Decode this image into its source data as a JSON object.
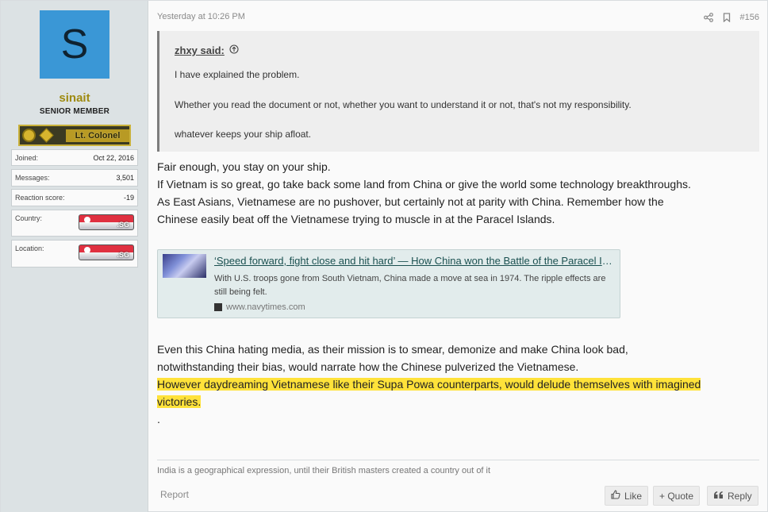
{
  "user": {
    "avatar_letter": "S",
    "avatar_color": "#3a97d6",
    "name": "sinait",
    "name_color": "#9e8a10",
    "title": "SENIOR MEMBER",
    "rank": "Lt. Colonel",
    "stats": [
      {
        "label": "Joined:",
        "value": "Oct 22, 2016"
      },
      {
        "label": "Messages:",
        "value": "3,501"
      },
      {
        "label": "Reaction score:",
        "value": "-19"
      }
    ],
    "country_label": "Country:",
    "location_label": "Location:",
    "flag_code": ".SG"
  },
  "post": {
    "timestamp": "Yesterday at 10:26 PM",
    "share_icon": "share-icon",
    "bookmark_icon": "bookmark-icon",
    "post_number": "#156",
    "quote": {
      "author": "zhxy said:",
      "lines": [
        "I have explained the problem.",
        "Whether you read the document or not, whether you want to understand it or not, that's not my responsibility.",
        "whatever keeps your ship afloat."
      ]
    },
    "paragraph1": [
      "Fair enough, you stay on your ship.",
      "If Vietnam is so great, go take back some land from China or give the world some technology breakthroughs.",
      "As East Asians, Vietnamese are no pushover, but certainly not at parity with China. Remember how the",
      "Chinese easily beat off the Vietnamese trying to muscle in at the Paracel Islands."
    ],
    "link_card": {
      "title": "‘Speed forward, fight close and hit hard’ — How China won the Battle of the Paracel Islands",
      "description": "With U.S. troops gone from South Vietnam, China made a move at sea in 1974. The ripple effects are still being felt.",
      "domain": "www.navytimes.com"
    },
    "paragraph2": [
      "Even this China hating media, as their mission is to smear, demonize and make China look bad,",
      "notwithstanding their bias, would narrate how the Chinese pulverized the Vietnamese."
    ],
    "highlighted": [
      "However daydreaming Vietnamese like their Supa Powa counterparts, would delude themselves with imagined",
      "victories."
    ],
    "trailing": ".",
    "highlight_color": "#ffe23a",
    "signature": "India is a geographical expression, until their British masters created a country out of it"
  },
  "actions": {
    "report": "Report",
    "like": "Like",
    "quote": "+ Quote",
    "reply": "Reply"
  }
}
